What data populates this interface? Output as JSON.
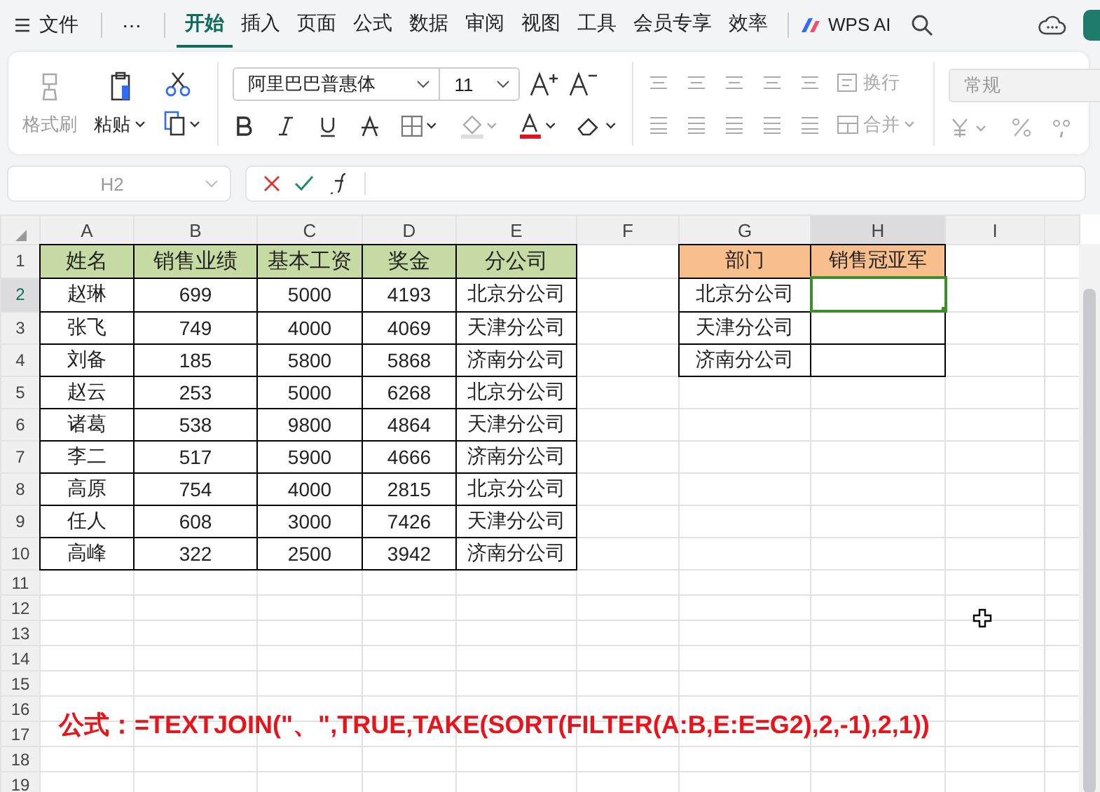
{
  "menu": {
    "file": "文件",
    "more": "⋯",
    "tabs": [
      {
        "label": "开始",
        "selected": true
      },
      {
        "label": "插入",
        "selected": false
      },
      {
        "label": "页面",
        "selected": false
      },
      {
        "label": "公式",
        "selected": false
      },
      {
        "label": "数据",
        "selected": false
      },
      {
        "label": "审阅",
        "selected": false
      },
      {
        "label": "视图",
        "selected": false
      },
      {
        "label": "工具",
        "selected": false
      },
      {
        "label": "会员专享",
        "selected": false
      },
      {
        "label": "效率",
        "selected": false
      }
    ],
    "ai": "WPS AI"
  },
  "ribbon": {
    "clipboard": [
      {
        "kind": "format_painter",
        "label": "格式刷",
        "disabled": true
      },
      {
        "kind": "paste",
        "label": "粘贴",
        "disabled": false
      }
    ],
    "font": {
      "name": "阿里巴巴普惠体",
      "size": "11"
    },
    "wrap": {
      "label": "换行",
      "disabled": true
    },
    "merge": {
      "label": "合并",
      "disabled": true
    },
    "number_format": {
      "value": "常规",
      "disabled": true
    }
  },
  "formula_bar": {
    "name_box": "H2"
  },
  "sheet": {
    "columns": [
      {
        "label": "A",
        "selected": false
      },
      {
        "label": "B",
        "selected": false
      },
      {
        "label": "C",
        "selected": false
      },
      {
        "label": "D",
        "selected": false
      },
      {
        "label": "E",
        "selected": false
      },
      {
        "label": "F",
        "selected": false
      },
      {
        "label": "G",
        "selected": false
      },
      {
        "label": "H",
        "selected": true
      },
      {
        "label": "I",
        "selected": false
      }
    ],
    "rows": [
      {
        "label": "1",
        "selected": false
      },
      {
        "label": "2",
        "selected": true
      },
      {
        "label": "3",
        "selected": false
      },
      {
        "label": "4",
        "selected": false
      },
      {
        "label": "5",
        "selected": false
      },
      {
        "label": "6",
        "selected": false
      },
      {
        "label": "7",
        "selected": false
      },
      {
        "label": "8",
        "selected": false
      },
      {
        "label": "9",
        "selected": false
      },
      {
        "label": "10",
        "selected": false
      },
      {
        "label": "11",
        "selected": false
      },
      {
        "label": "12",
        "selected": false
      },
      {
        "label": "13",
        "selected": false
      },
      {
        "label": "14",
        "selected": false
      },
      {
        "label": "15",
        "selected": false
      },
      {
        "label": "16",
        "selected": false
      },
      {
        "label": "17",
        "selected": false
      },
      {
        "label": "18",
        "selected": false
      },
      {
        "label": "19",
        "selected": false
      }
    ],
    "data_table": {
      "header": [
        "姓名",
        "销售业绩",
        "基本工资",
        "奖金",
        "分公司"
      ],
      "rows": [
        [
          "赵琳",
          "699",
          "5000",
          "4193",
          "北京分公司"
        ],
        [
          "张飞",
          "749",
          "4000",
          "4069",
          "天津分公司"
        ],
        [
          "刘备",
          "185",
          "5800",
          "5868",
          "济南分公司"
        ],
        [
          "赵云",
          "253",
          "5000",
          "6268",
          "北京分公司"
        ],
        [
          "诸葛",
          "538",
          "9800",
          "4864",
          "天津分公司"
        ],
        [
          "李二",
          "517",
          "5900",
          "4666",
          "济南分公司"
        ],
        [
          "高原",
          "754",
          "4000",
          "2815",
          "北京分公司"
        ],
        [
          "任人",
          "608",
          "3000",
          "7426",
          "天津分公司"
        ],
        [
          "高峰",
          "322",
          "2500",
          "3942",
          "济南分公司"
        ]
      ]
    },
    "lookup_table": {
      "header": [
        "部门",
        "销售冠亚军"
      ],
      "rows": [
        {
          "department": "北京分公司"
        },
        {
          "department": "天津分公司"
        },
        {
          "department": "济南分公司"
        }
      ]
    }
  },
  "note": "公式：=TEXTJOIN(\"、\",TRUE,TAKE(SORT(FILTER(A:B,E:E=G2),2,-1),2,1))"
}
